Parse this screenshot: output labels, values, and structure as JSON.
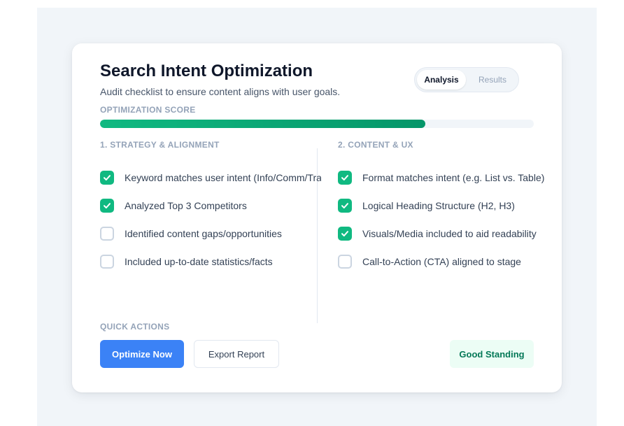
{
  "header": {
    "title": "Search Intent Optimization",
    "subtitle": "Audit checklist to ensure content aligns with user goals."
  },
  "tabs": [
    {
      "label": "Analysis",
      "active": true
    },
    {
      "label": "Results",
      "active": false
    }
  ],
  "score": {
    "label": "OPTIMIZATION SCORE",
    "value_percent": 75,
    "color": "#10b981"
  },
  "columns": [
    {
      "title": "1. STRATEGY & ALIGNMENT",
      "items": [
        {
          "label": "Keyword matches user intent (Info/Comm/Trans/Nav)",
          "checked": true
        },
        {
          "label": "Analyzed Top 3 Competitors",
          "checked": true
        },
        {
          "label": "Identified content gaps/opportunities",
          "checked": false
        },
        {
          "label": "Included up-to-date statistics/facts",
          "checked": false
        }
      ]
    },
    {
      "title": "2. CONTENT & UX",
      "items": [
        {
          "label": "Format matches intent (e.g. List vs. Table)",
          "checked": true
        },
        {
          "label": "Logical Heading Structure (H2, H3)",
          "checked": true
        },
        {
          "label": "Visuals/Media included to aid readability",
          "checked": true
        },
        {
          "label": "Call-to-Action (CTA) aligned to stage",
          "checked": false
        }
      ]
    }
  ],
  "actions": {
    "label": "QUICK ACTIONS",
    "optimize_label": "Optimize Now",
    "export_label": "Export Report"
  },
  "status": {
    "label": "Good Standing"
  },
  "colors": {
    "accent_green": "#10b981",
    "primary_blue": "#3b82f6",
    "status_bg": "#ecfdf5",
    "status_text": "#047857"
  },
  "icons": {
    "checkbox_checked": "check-icon"
  }
}
